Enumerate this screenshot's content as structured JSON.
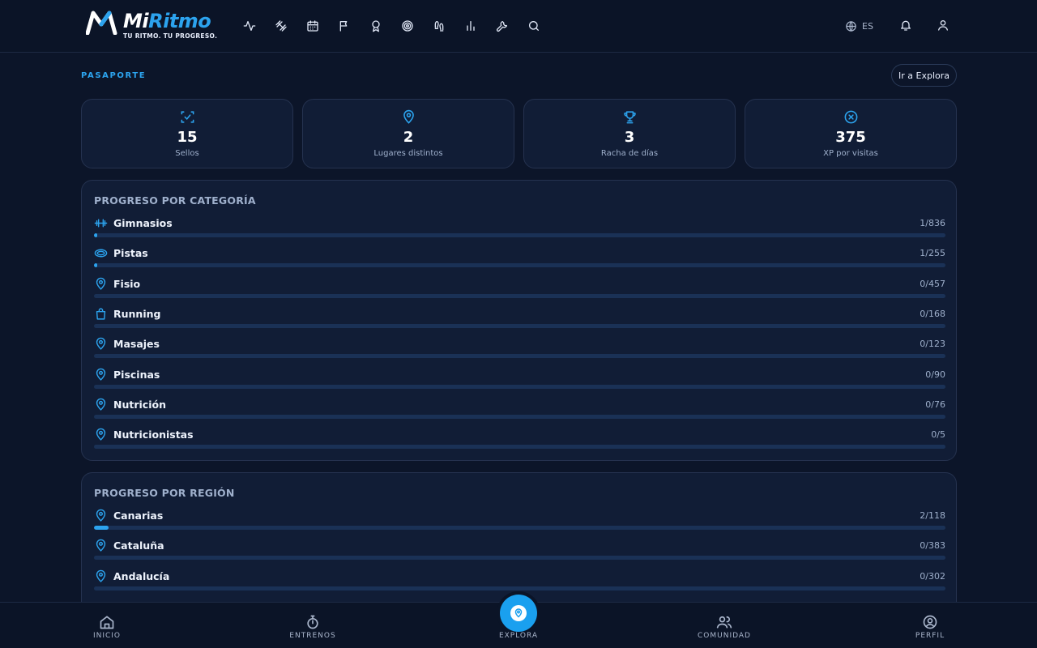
{
  "app": {
    "brand_prefix": "Mi",
    "brand_suffix": "Ritmo",
    "tagline": "TU RITMO. TU PROGRESO.",
    "accent_color": "#2ca3ee"
  },
  "header": {
    "nav_icons": [
      "activity-icon",
      "dumbbell-icon",
      "calendar-icon",
      "flag-icon",
      "award-icon",
      "target-icon",
      "footprints-icon",
      "bar-chart-icon",
      "wrench-icon",
      "search-icon"
    ],
    "language": "ES"
  },
  "passport": {
    "section_label": "PASAPORTE",
    "explore_button": "Ir a Explora",
    "stats": [
      {
        "icon": "stamp-check-icon",
        "value": "15",
        "label": "Sellos"
      },
      {
        "icon": "map-pin-icon",
        "value": "2",
        "label": "Lugares distintos"
      },
      {
        "icon": "trophy-icon",
        "value": "3",
        "label": "Racha de días"
      },
      {
        "icon": "xp-icon",
        "value": "375",
        "label": "XP por visitas"
      }
    ]
  },
  "category_progress": {
    "title": "PROGRESO POR CATEGORÍA",
    "items": [
      {
        "icon": "dumbbell-icon",
        "name": "Gimnasios",
        "count": "1/836",
        "progress": 0.0012
      },
      {
        "icon": "track-icon",
        "name": "Pistas",
        "count": "1/255",
        "progress": 0.0039
      },
      {
        "icon": "map-pin-icon",
        "name": "Fisio",
        "count": "0/457",
        "progress": 0
      },
      {
        "icon": "shopping-bag-icon",
        "name": "Running",
        "count": "0/168",
        "progress": 0
      },
      {
        "icon": "map-pin-icon",
        "name": "Masajes",
        "count": "0/123",
        "progress": 0
      },
      {
        "icon": "map-pin-icon",
        "name": "Piscinas",
        "count": "0/90",
        "progress": 0
      },
      {
        "icon": "map-pin-icon",
        "name": "Nutrición",
        "count": "0/76",
        "progress": 0
      },
      {
        "icon": "map-pin-icon",
        "name": "Nutricionistas",
        "count": "0/5",
        "progress": 0
      }
    ]
  },
  "region_progress": {
    "title": "PROGRESO POR REGIÓN",
    "items": [
      {
        "icon": "map-pin-icon",
        "name": "Canarias",
        "count": "2/118",
        "progress": 0.0169
      },
      {
        "icon": "map-pin-icon",
        "name": "Cataluña",
        "count": "0/383",
        "progress": 0
      },
      {
        "icon": "map-pin-icon",
        "name": "Andalucía",
        "count": "0/302",
        "progress": 0
      }
    ]
  },
  "bottom_nav": {
    "items": [
      {
        "icon": "home-icon",
        "label": "INICIO"
      },
      {
        "icon": "stopwatch-icon",
        "label": "ENTRENOS"
      },
      {
        "icon": "map-pin-icon",
        "label": "EXPLORA",
        "active": true
      },
      {
        "icon": "users-icon",
        "label": "COMUNIDAD"
      },
      {
        "icon": "user-circle-icon",
        "label": "PERFIL"
      }
    ]
  }
}
